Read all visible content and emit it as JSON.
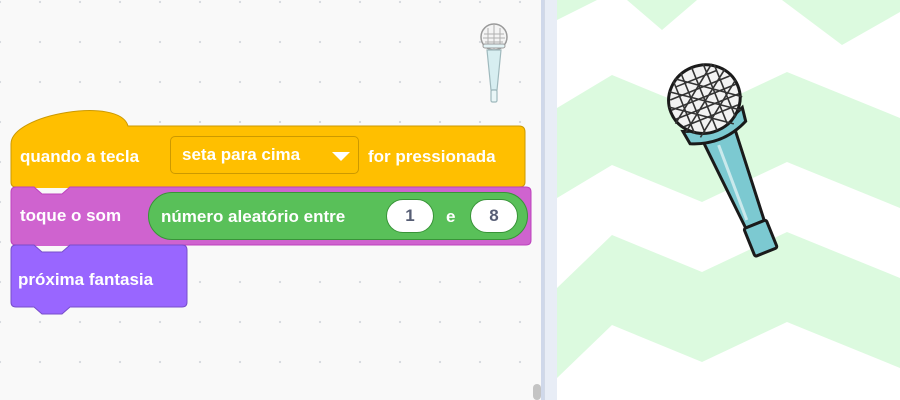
{
  "code_area": {
    "hat_block": {
      "label_before": "quando a tecla",
      "key_value": "seta para cima",
      "label_after": "for pressionada",
      "color": "#ffbf00"
    },
    "sound_block": {
      "label": "toque o som",
      "color": "#cf63cf",
      "reporter": {
        "label": "número aleatório entre",
        "min": "1",
        "connector": "e",
        "max": "8",
        "color": "#59c059"
      }
    },
    "costume_block": {
      "label": "próxima fantasia",
      "color": "#9966ff"
    },
    "sprite_thumbnail_icon": "microphone-icon"
  },
  "stage": {
    "backdrop": "green-zigzag",
    "sprite_icon": "microphone-icon",
    "colors": {
      "zigzag": "#dcfadf",
      "mic_body": "#7cc9d1",
      "mic_grille": "#3d3d3d"
    }
  }
}
